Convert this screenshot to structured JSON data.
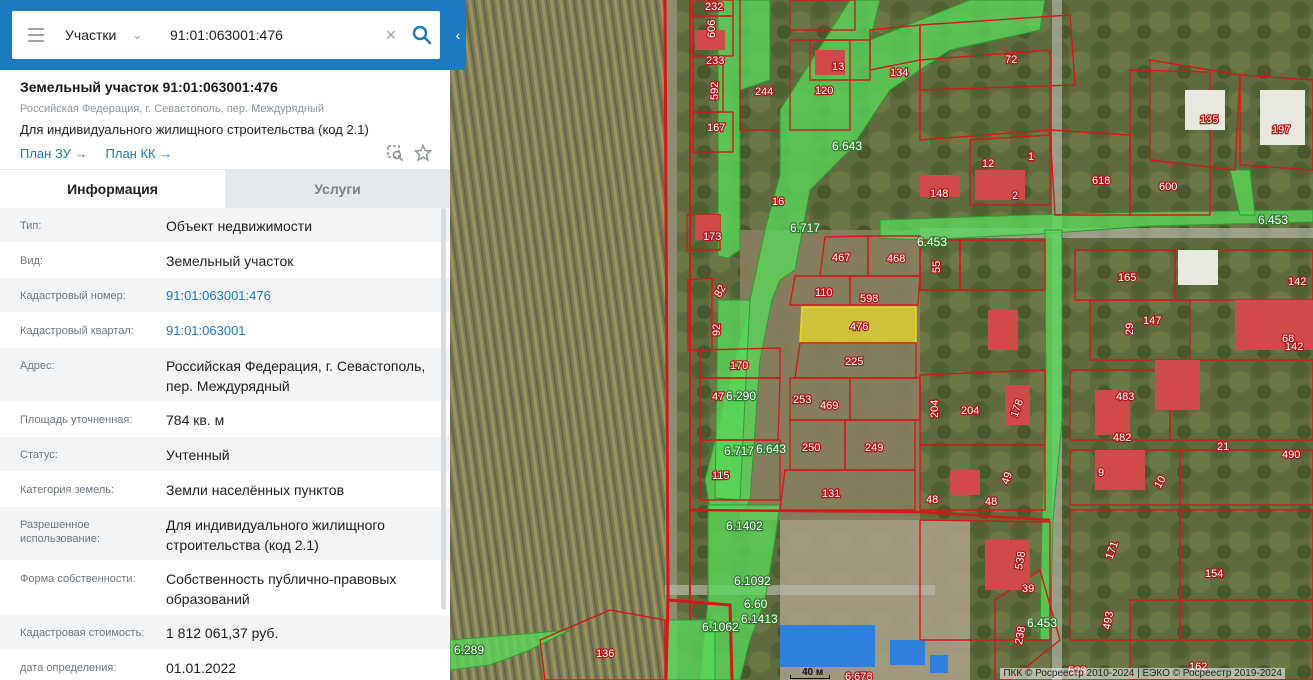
{
  "search": {
    "type_label": "Участки",
    "query": "91:01:063001:476"
  },
  "object": {
    "title": "Земельный участок 91:01:063001:476",
    "address_short": "Российская Федерация, г. Севастополь, пер. Междурядный",
    "use": "Для индивидуального жилищного строительства (код 2.1)",
    "link_plan_zu": "План ЗУ →",
    "link_plan_kk": "План КК →"
  },
  "tabs": {
    "info": "Информация",
    "services": "Услуги"
  },
  "rows": [
    {
      "label": "Тип:",
      "value": "Объект недвижимости",
      "link": false
    },
    {
      "label": "Вид:",
      "value": "Земельный участок",
      "link": false
    },
    {
      "label": "Кадастровый номер:",
      "value": "91:01:063001:476",
      "link": true
    },
    {
      "label": "Кадастровый квартал:",
      "value": "91:01:063001",
      "link": true
    },
    {
      "label": "Адрес:",
      "value": "Российская Федерация, г. Севастополь, пер. Междурядный",
      "link": false
    },
    {
      "label": "Площадь уточненная:",
      "value": "784 кв. м",
      "link": false
    },
    {
      "label": "Статус:",
      "value": "Учтенный",
      "link": false
    },
    {
      "label": "Категория земель:",
      "value": "Земли населённых пунктов",
      "link": false
    },
    {
      "label": "Разрешенное использование:",
      "value": "Для индивидуального жилищного строительства (код 2.1)",
      "link": false
    },
    {
      "label": "Форма собственности:",
      "value": "Собственность публично-правовых образований",
      "link": false
    },
    {
      "label": "Кадастровая стоимость:",
      "value": "1 812 061,37 руб.",
      "link": false
    },
    {
      "label": "дата определения:",
      "value": "01.01.2022",
      "link": false
    }
  ],
  "map": {
    "parcel_labels": [
      "232",
      "606",
      "233",
      "592",
      "167",
      "244",
      "13",
      "120",
      "134",
      "72",
      "135",
      "197",
      "173",
      "16",
      "12",
      "1",
      "148",
      "2",
      "618",
      "600",
      "467",
      "468",
      "55",
      "165",
      "142",
      "82",
      "110",
      "598",
      "476",
      "147",
      "29",
      "68",
      "142",
      "92",
      "170",
      "225",
      "253",
      "469",
      "204",
      "204",
      "178",
      "483",
      "482",
      "21",
      "490",
      "47",
      "250",
      "249",
      "9",
      "10",
      "115",
      "131",
      "48",
      "48",
      "49",
      "171",
      "538",
      "39",
      "154",
      "493",
      "238",
      "136",
      "162",
      "528",
      "6.678"
    ],
    "zone_labels": [
      "6.643",
      "6.717",
      "6.453",
      "6.453",
      "6.290",
      "6.717",
      "6.643",
      "6.1402",
      "6.1092",
      "6.60",
      "6.1413",
      "6.1062",
      "6.453",
      "6.289"
    ],
    "scale_label": "40 м",
    "copyright": "ПКК © Росреестр 2010-2024 | ЕЭКО © Росреестр 2019-2024"
  },
  "colors": {
    "header_blue": "#1c7bbf",
    "parcel_border": "#d01a1a",
    "zone_green": "#58d858",
    "selected_yellow": "#f2ea2a"
  }
}
